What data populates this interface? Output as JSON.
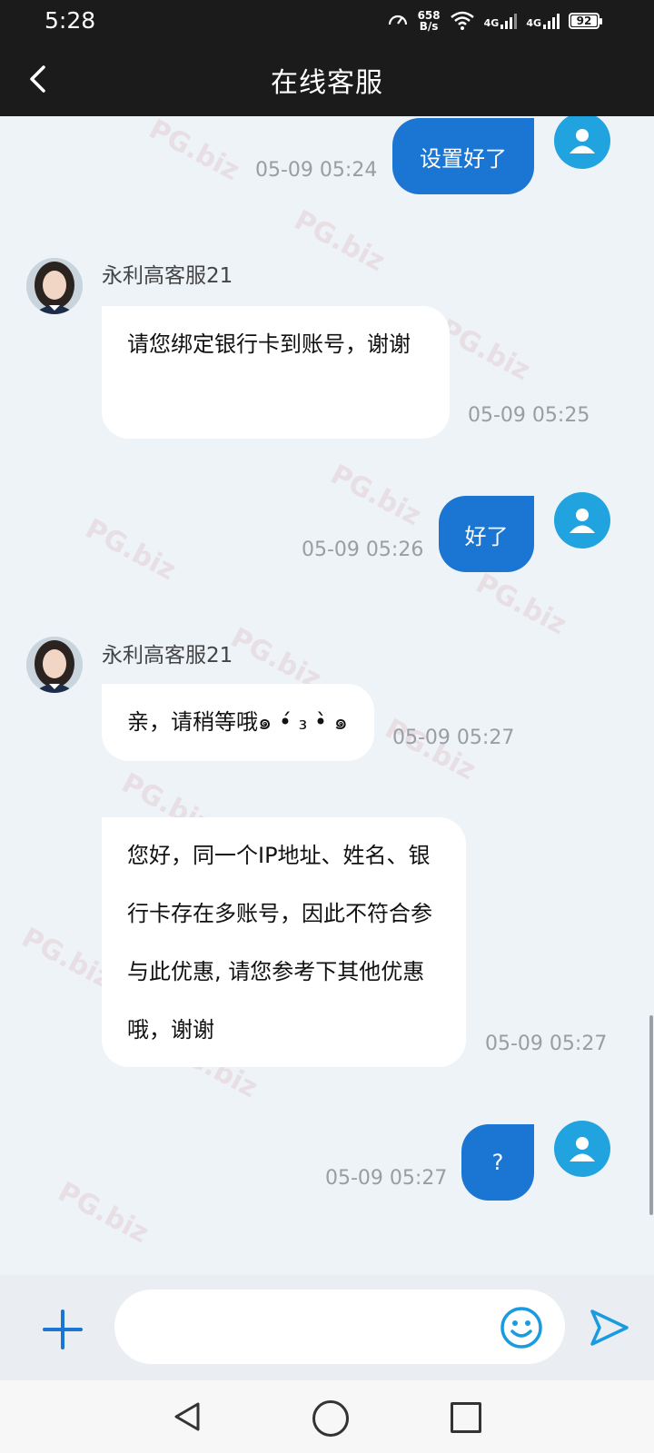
{
  "status_bar": {
    "time": "5:28",
    "net_speed_value": "658",
    "net_speed_unit": "B/s",
    "signal_1": "4G",
    "signal_2": "4G",
    "battery": "92"
  },
  "header": {
    "title": "在线客服"
  },
  "watermark": "PG.biz",
  "messages": [
    {
      "from": "user",
      "text": "设置好了",
      "time": "05-09 05:24"
    },
    {
      "from": "agent",
      "name": "永利高客服21",
      "text": "请您绑定银行卡到账号，谢谢",
      "time": "05-09 05:25"
    },
    {
      "from": "user",
      "text": "好了",
      "time": "05-09 05:26"
    },
    {
      "from": "agent",
      "name": "永利高客服21",
      "text": "亲，请稍等哦๑ •́ ₃ •̀ ๑",
      "time": "05-09 05:27"
    },
    {
      "from": "agent",
      "text": "您好，同一个IP地址、姓名、银行卡存在多账号，因此不符合参与此优惠, 请您参考下其他优惠哦，谢谢",
      "time": "05-09 05:27"
    },
    {
      "from": "user",
      "text": "?",
      "time": "05-09 05:27"
    }
  ],
  "input": {
    "placeholder": ""
  },
  "colors": {
    "bubble_out": "#1a76d2",
    "avatar_user": "#20a3df",
    "accent": "#1a76d2"
  }
}
